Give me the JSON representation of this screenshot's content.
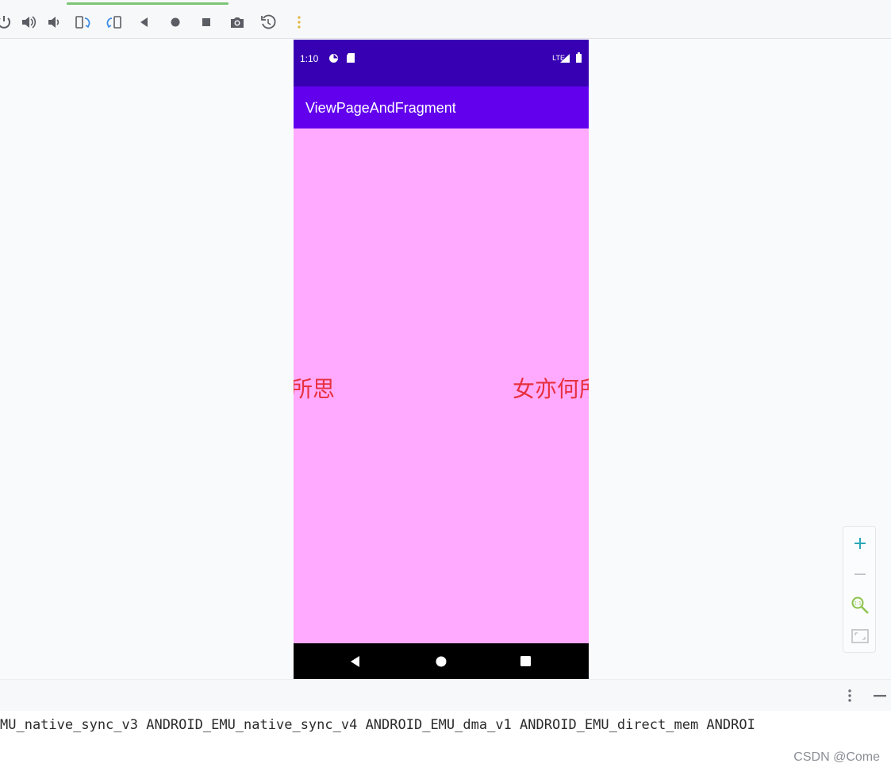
{
  "toolbar": {
    "buttons": [
      {
        "name": "power-icon"
      },
      {
        "name": "volume-up-icon"
      },
      {
        "name": "volume-down-icon"
      },
      {
        "name": "rotate-left-icon"
      },
      {
        "name": "rotate-right-icon"
      },
      {
        "name": "back-icon"
      },
      {
        "name": "home-icon"
      },
      {
        "name": "overview-icon"
      },
      {
        "name": "camera-icon"
      },
      {
        "name": "snapshot-icon"
      },
      {
        "name": "more-vertical-icon"
      }
    ]
  },
  "device": {
    "status_bar": {
      "time": "1:10",
      "network": "LTE"
    },
    "app_bar": {
      "title": "ViewPageAndFragment"
    },
    "pager": {
      "left_page_text": "所思",
      "right_page_text": "女亦何所"
    },
    "colors": {
      "status_bar": "#3700b3",
      "app_bar": "#6200ee",
      "content": "#ffaaff",
      "page_text": "#e8303e"
    }
  },
  "zoom": {
    "buttons": [
      {
        "name": "zoom-in-icon"
      },
      {
        "name": "zoom-out-icon"
      },
      {
        "name": "zoom-actual-size-icon"
      },
      {
        "name": "zoom-fit-icon"
      }
    ]
  },
  "log": {
    "line": "MU_native_sync_v3 ANDROID_EMU_native_sync_v4 ANDROID_EMU_dma_v1 ANDROID_EMU_direct_mem ANDROI"
  },
  "watermark": "CSDN @Come"
}
